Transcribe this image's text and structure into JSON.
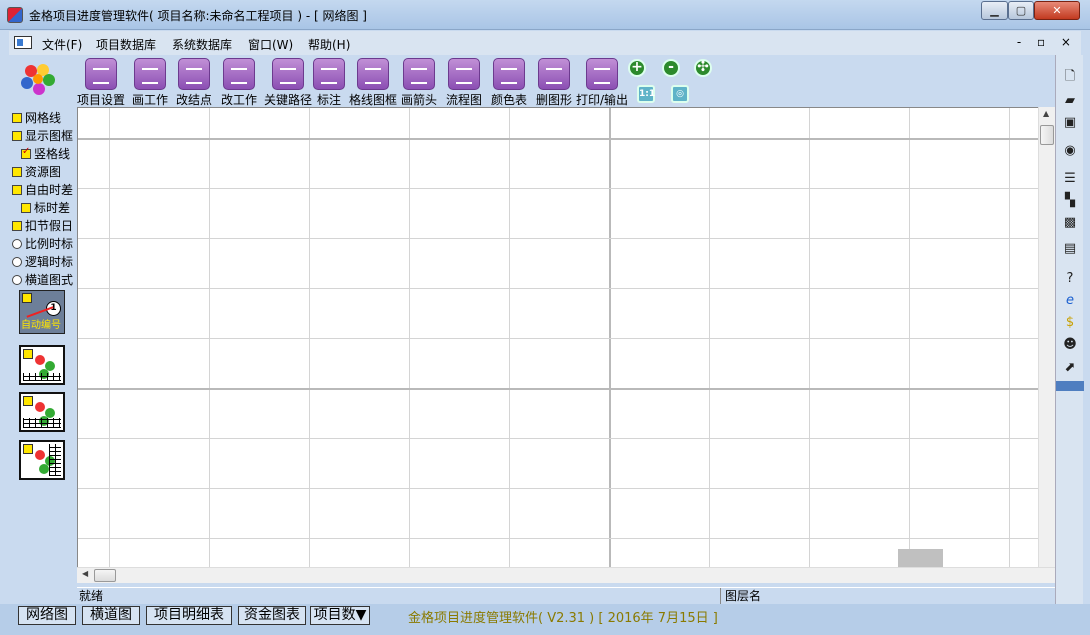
{
  "window": {
    "title": "金格项目进度管理软件( 项目名称:未命名工程项目 ) - [ 网络图 ]"
  },
  "menu": {
    "items": [
      "文件(F)",
      "项目数据库",
      "系统数据库",
      "窗口(W)",
      "帮助(H)"
    ],
    "mdi_controls": "- ▫ ×"
  },
  "toolbar": {
    "tools": [
      "项目设置",
      "画工作",
      "改结点",
      "改工作",
      "关键路径",
      "标注",
      "格线图框",
      "画箭头",
      "流程图",
      "颜色表",
      "删图形",
      "打印/输出"
    ],
    "zoom_in": "+",
    "zoom_out": "-",
    "fit": "✣",
    "one_to_one": "1:1",
    "target": "◎"
  },
  "left_panel": {
    "options": [
      {
        "label": "网格线",
        "type": "checkbox",
        "checked": true
      },
      {
        "label": "显示图框",
        "type": "checkbox",
        "checked": true
      },
      {
        "label": "竖格线",
        "type": "checkbox",
        "checked": true
      },
      {
        "label": "资源图",
        "type": "checkbox",
        "checked": true
      },
      {
        "label": "自由时差",
        "type": "checkbox",
        "checked": true
      },
      {
        "label": "标时差",
        "type": "checkbox",
        "checked": true
      },
      {
        "label": "扣节假日",
        "type": "checkbox",
        "checked": true
      },
      {
        "label": "比例时标",
        "type": "radio",
        "checked": false
      },
      {
        "label": "逻辑时标",
        "type": "radio",
        "checked": false
      },
      {
        "label": "横道图式",
        "type": "radio",
        "checked": false
      }
    ],
    "auto_number": {
      "label": "自动编号",
      "badge": "1"
    }
  },
  "status": {
    "left": "就绪",
    "right": "图层名"
  },
  "bottom_tabs": [
    "网络图",
    "横道图",
    "项目明细表",
    "资金图表",
    "项目数▼"
  ],
  "footer_info": "金格项目进度管理软件( V2.31 ) [ 2016年 7月15日 ]",
  "right_toolbar": {
    "icons": [
      "new-file-icon",
      "open-folder-icon",
      "save-icon",
      "view-icon",
      "list-icon",
      "hierarchy-icon",
      "camera-icon",
      "print-icon",
      "help-icon",
      "ie-icon",
      "dollar-icon",
      "person-icon",
      "export-icon"
    ]
  },
  "colors": {
    "title_gradient": "#b9d1ea",
    "checkbox_fill": "#ffe600",
    "footer_text": "#8a7a00"
  }
}
